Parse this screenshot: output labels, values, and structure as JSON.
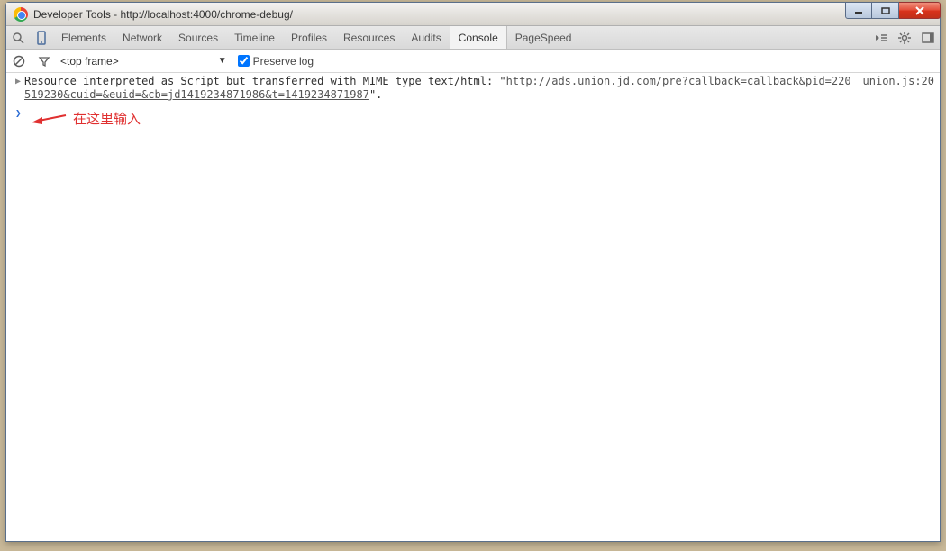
{
  "window": {
    "title": "Developer Tools - http://localhost:4000/chrome-debug/"
  },
  "toolbar": {
    "tabs": [
      {
        "label": "Elements"
      },
      {
        "label": "Network"
      },
      {
        "label": "Sources"
      },
      {
        "label": "Timeline"
      },
      {
        "label": "Profiles"
      },
      {
        "label": "Resources"
      },
      {
        "label": "Audits"
      },
      {
        "label": "Console",
        "active": true
      },
      {
        "label": "PageSpeed"
      }
    ]
  },
  "controlbar": {
    "frame_selector": "<top frame>",
    "preserve_label": "Preserve log",
    "preserve_checked": true
  },
  "console": {
    "message_prefix": "Resource interpreted as Script but transferred with MIME type text/html: \"",
    "message_url": "http://ads.union.jd.com/pre?callback=callback&pid=220519230&cuid=&euid=&cb=jd1419234871986&t=1419234871987",
    "message_suffix": "\".",
    "source_link": "union.js:20"
  },
  "annotation": {
    "text": "在这里输入"
  }
}
